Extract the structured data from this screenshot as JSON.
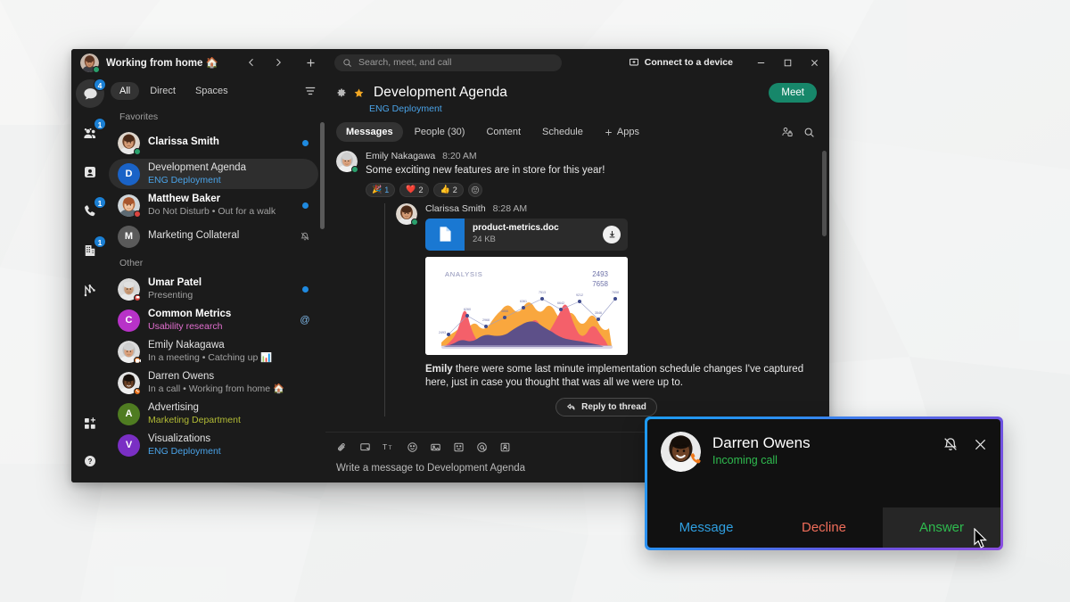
{
  "window": {
    "status_label": "Working from home 🏠",
    "nav": {
      "back": "back-icon",
      "forward": "forward-icon",
      "add": "plus-icon"
    },
    "controls": {
      "minimize": "minimize",
      "maximize": "maximize",
      "close": "close"
    }
  },
  "rail": {
    "items": [
      {
        "name": "messaging",
        "icon": "chat-bubble-icon",
        "badge": "4",
        "active": true
      },
      {
        "name": "teams",
        "icon": "people-icon",
        "badge": "1",
        "active": false
      },
      {
        "name": "contacts",
        "icon": "contact-card-icon",
        "badge": "",
        "active": false
      },
      {
        "name": "calling",
        "icon": "phone-icon",
        "badge": "1",
        "active": false
      },
      {
        "name": "meetings",
        "icon": "building-icon",
        "badge": "1",
        "active": false
      },
      {
        "name": "workflows",
        "icon": "workflow-icon",
        "badge": "",
        "active": false
      }
    ],
    "bottom": [
      {
        "name": "add-apps",
        "icon": "apps-add-icon"
      },
      {
        "name": "help",
        "icon": "question-circle-icon"
      }
    ]
  },
  "filters": {
    "tabs": [
      {
        "label": "All",
        "active": true
      },
      {
        "label": "Direct",
        "active": false
      },
      {
        "label": "Spaces",
        "active": false
      }
    ],
    "sort_icon": "filter-sort-icon"
  },
  "conversations": {
    "sections": [
      {
        "title": "Favorites",
        "items": [
          {
            "name": "Clarissa Smith",
            "sub": "",
            "sub_color": "",
            "unread": true,
            "avatar_type": "photo",
            "avatar_photo": "clarissa",
            "avatar_color": "",
            "initial": "",
            "presence": "available",
            "right": "unread-dot"
          },
          {
            "name": "Development Agenda",
            "sub": "ENG Deployment",
            "sub_color": "blue",
            "unread": false,
            "avatar_type": "initial",
            "avatar_photo": "",
            "avatar_color": "#1a63c7",
            "initial": "D",
            "presence": "",
            "right": "",
            "selected": true
          },
          {
            "name": "Matthew Baker",
            "sub": "Do Not Disturb  •  Out for a walk",
            "sub_color": "",
            "unread": true,
            "avatar_type": "photo",
            "avatar_photo": "matthew",
            "avatar_color": "",
            "initial": "",
            "presence": "dnd",
            "right": "unread-dot"
          },
          {
            "name": "Marketing Collateral",
            "sub": "",
            "sub_color": "",
            "unread": false,
            "avatar_type": "initial",
            "avatar_photo": "",
            "avatar_color": "#5a5a5a",
            "initial": "M",
            "presence": "",
            "right": "muted"
          }
        ]
      },
      {
        "title": "Other",
        "items": [
          {
            "name": "Umar Patel",
            "sub": "Presenting",
            "sub_color": "",
            "unread": true,
            "avatar_type": "photo",
            "avatar_photo": "umar",
            "avatar_color": "",
            "initial": "",
            "presence": "presenting",
            "right": "unread-dot"
          },
          {
            "name": "Common Metrics",
            "sub": "Usability research",
            "sub_color": "pink",
            "unread": true,
            "avatar_type": "initial",
            "avatar_photo": "",
            "avatar_color": "#b832c8",
            "initial": "C",
            "presence": "",
            "right": "mention"
          },
          {
            "name": "Emily Nakagawa",
            "sub": "In a meeting  •  Catching up 📊",
            "sub_color": "",
            "unread": false,
            "avatar_type": "photo",
            "avatar_photo": "emily",
            "avatar_color": "",
            "initial": "",
            "presence": "meeting",
            "right": ""
          },
          {
            "name": "Darren Owens",
            "sub": "In a call  •  Working from home 🏠",
            "sub_color": "",
            "unread": false,
            "avatar_type": "photo",
            "avatar_photo": "darren",
            "avatar_color": "",
            "initial": "",
            "presence": "call",
            "right": ""
          },
          {
            "name": "Advertising",
            "sub": "Marketing Department",
            "sub_color": "olive",
            "unread": false,
            "avatar_type": "initial",
            "avatar_photo": "",
            "avatar_color": "#4f7c21",
            "initial": "A",
            "presence": "",
            "right": ""
          },
          {
            "name": "Visualizations",
            "sub": "ENG Deployment",
            "sub_color": "blue",
            "unread": false,
            "avatar_type": "initial",
            "avatar_photo": "",
            "avatar_color": "#7a2fc4",
            "initial": "V",
            "presence": "",
            "right": ""
          }
        ]
      }
    ]
  },
  "search": {
    "placeholder": "Search, meet, and call",
    "icon": "search-icon"
  },
  "connect_device": {
    "label": "Connect to a device",
    "icon": "device-icon"
  },
  "space": {
    "title": "Development Agenda",
    "subtitle": "ENG Deployment",
    "settings_icon": "gear-icon",
    "favorite_icon": "star-icon",
    "meet_label": "Meet",
    "tabs": [
      {
        "label": "Messages",
        "active": true
      },
      {
        "label": "People (30)",
        "active": false
      },
      {
        "label": "Content",
        "active": false
      },
      {
        "label": "Schedule",
        "active": false
      },
      {
        "label": "Apps",
        "active": false,
        "plus": true
      }
    ],
    "right_icons": [
      "pin-people-icon",
      "search-icon"
    ]
  },
  "messages": [
    {
      "author": "Emily Nakagawa",
      "time": "8:20 AM",
      "text": "Some exciting new features are in store for this year!",
      "avatar_photo": "emily",
      "presence": "available",
      "reactions": [
        {
          "emoji": "🎉",
          "count": "1",
          "mine": true
        },
        {
          "emoji": "❤️",
          "count": "2",
          "mine": false
        },
        {
          "emoji": "👍",
          "count": "2",
          "mine": false
        }
      ],
      "add_reaction_icon": "add-reaction-icon"
    }
  ],
  "thread": {
    "author": "Clarissa Smith",
    "time": "8:28 AM",
    "avatar_photo": "clarissa",
    "presence": "available",
    "file": {
      "name": "product-metrics.doc",
      "size": "24 KB",
      "icon": "document-icon",
      "download_icon": "download-icon"
    },
    "text_bold_lead": "Emily",
    "text_rest": " there were some last minute implementation schedule changes I've captured here, just in case you thought that was all we were up to."
  },
  "reply": {
    "label": "Reply to thread",
    "icon": "reply-icon"
  },
  "composer": {
    "placeholder": "Write a message to Development Agenda",
    "icons": [
      "attachment-icon",
      "screen-capture-icon",
      "format-text-icon",
      "emoji-icon",
      "image-icon",
      "sticker-icon",
      "mention-icon",
      "card-icon"
    ]
  },
  "call_popup": {
    "caller": "Darren Owens",
    "state": "Incoming call",
    "mute_icon": "bell-mute-icon",
    "close_icon": "close-icon",
    "actions": [
      {
        "label": "Message",
        "kind": "message"
      },
      {
        "label": "Decline",
        "kind": "decline"
      },
      {
        "label": "Answer",
        "kind": "answer"
      }
    ]
  },
  "chart_data": {
    "type": "area",
    "title": "ANALYSIS",
    "corner_values": [
      "2493",
      "7658"
    ],
    "series": [
      {
        "name": "markers",
        "values": [
          2493,
          6260,
          2968,
          4866,
          6361,
          7513,
          6642,
          9212,
          3546,
          7658
        ]
      },
      {
        "name": "red-area",
        "color": "#f4606a"
      },
      {
        "name": "orange-area",
        "color": "#f9a73e"
      },
      {
        "name": "purple-area",
        "color": "#5d5089"
      }
    ],
    "xlabel": "",
    "ylabel": "",
    "grid": false,
    "legend": "none"
  }
}
